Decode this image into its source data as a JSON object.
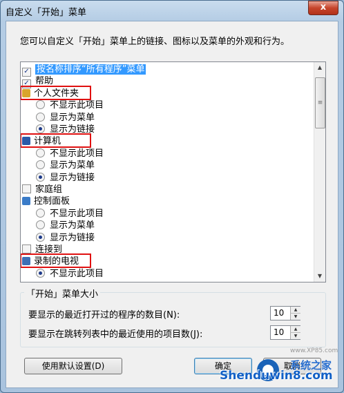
{
  "window": {
    "title": "自定义「开始」菜单",
    "close_glyph": "x"
  },
  "intro_text": "您可以自定义「开始」菜单上的链接、图标以及菜单的外观和行为。",
  "list_items": [
    {
      "type": "checkbox",
      "checked": true,
      "label": "按名称排序“所有程序”菜单",
      "selected": true
    },
    {
      "type": "checkbox",
      "checked": true,
      "label": "帮助"
    },
    {
      "type": "header",
      "icon": "folder-user-icon",
      "label": "个人文件夹"
    },
    {
      "type": "radio",
      "on": false,
      "label": "不显示此项目"
    },
    {
      "type": "radio",
      "on": false,
      "label": "显示为菜单"
    },
    {
      "type": "radio",
      "on": true,
      "label": "显示为链接"
    },
    {
      "type": "header",
      "icon": "computer-icon",
      "label": "计算机"
    },
    {
      "type": "radio",
      "on": false,
      "label": "不显示此项目"
    },
    {
      "type": "radio",
      "on": false,
      "label": "显示为菜单"
    },
    {
      "type": "radio",
      "on": true,
      "label": "显示为链接"
    },
    {
      "type": "checkbox",
      "checked": false,
      "label": "家庭组"
    },
    {
      "type": "header",
      "icon": "control-panel-icon",
      "label": "控制面板"
    },
    {
      "type": "radio",
      "on": false,
      "label": "不显示此项目"
    },
    {
      "type": "radio",
      "on": false,
      "label": "显示为菜单"
    },
    {
      "type": "radio",
      "on": true,
      "label": "显示为链接"
    },
    {
      "type": "checkbox",
      "checked": false,
      "label": "连接到"
    },
    {
      "type": "header",
      "icon": "recorded-tv-icon",
      "label": "录制的电视"
    },
    {
      "type": "radio",
      "on": true,
      "label": "不显示此项目"
    }
  ],
  "size_group": {
    "legend": "「开始」菜单大小",
    "recent_programs_label": "要显示的最近打开过的程序的数目(N):",
    "recent_programs_value": "10",
    "jump_list_label": "要显示在跳转列表中的最近使用的项目数(J):",
    "jump_list_value": "10"
  },
  "buttons": {
    "defaults": "使用默认设置(D)",
    "ok": "确定",
    "cancel": "取消"
  },
  "watermark": {
    "text": "Shenduwin8.com",
    "small": "www.XP85.com",
    "cn": "系统之家"
  },
  "colors": {
    "selection": "#3399ff",
    "highlight_box": "#e01010",
    "close_button": "#c6452c"
  }
}
